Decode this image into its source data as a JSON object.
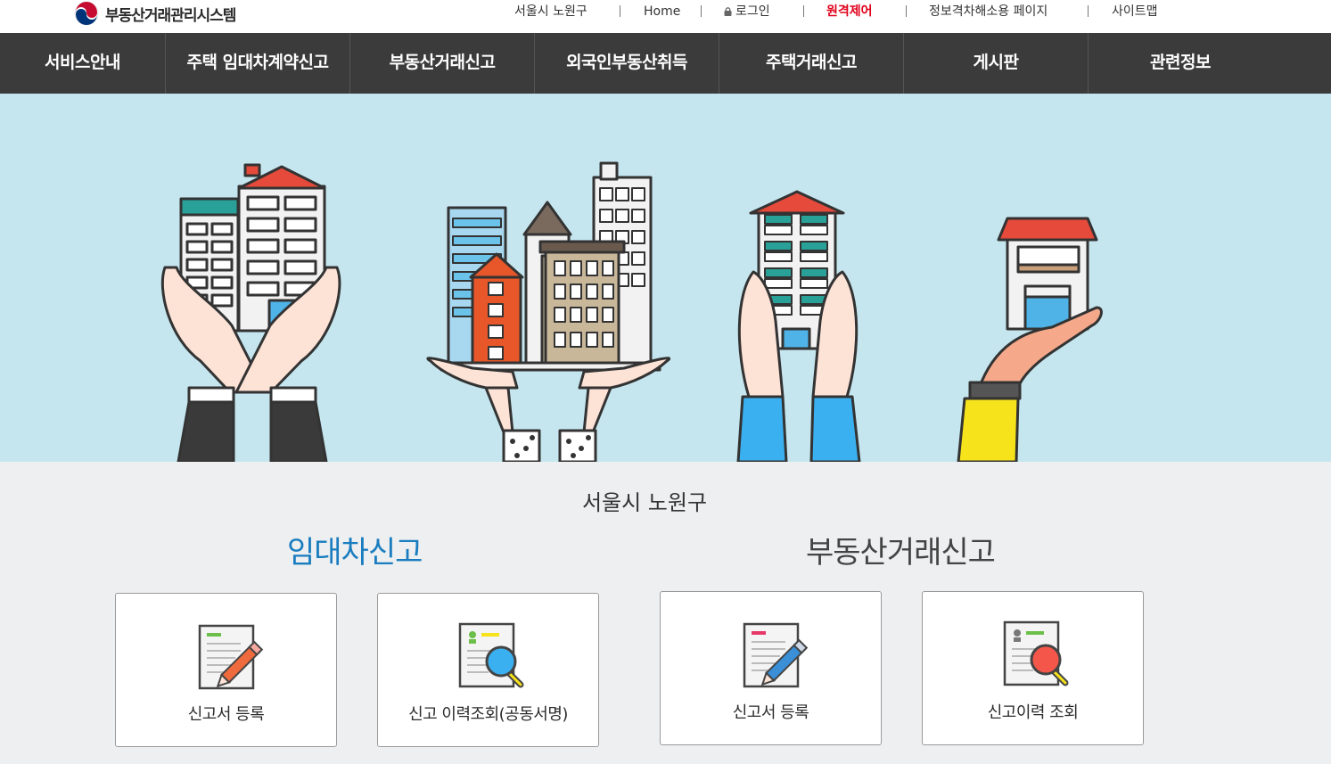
{
  "header": {
    "logo_text": "부동산거래관리시스템",
    "links": {
      "region": "서울시 노원구",
      "home": "Home",
      "login": "로그인",
      "remote": "원격제어",
      "accessibility": "정보격차해소용 페이지",
      "sitemap": "사이트맵"
    }
  },
  "nav": {
    "items": [
      "서비스안내",
      "주택 임대차계약신고",
      "부동산거래신고",
      "외국인부동산취득",
      "주택거래신고",
      "게시판",
      "관련정보"
    ]
  },
  "main": {
    "region_title": "서울시 노원구",
    "lease": {
      "title": "임대차신고",
      "register": "신고서 등록",
      "history": "신고 이력조회(공동서명)"
    },
    "trade": {
      "title": "부동산거래신고",
      "register": "신고서 등록",
      "history": "신고이력 조회"
    }
  },
  "colors": {
    "nav_bg": "#3b3b3b",
    "hero_bg": "#c5e6ef",
    "accent_blue": "#1a7dbf",
    "remote_red": "#e0001b"
  }
}
